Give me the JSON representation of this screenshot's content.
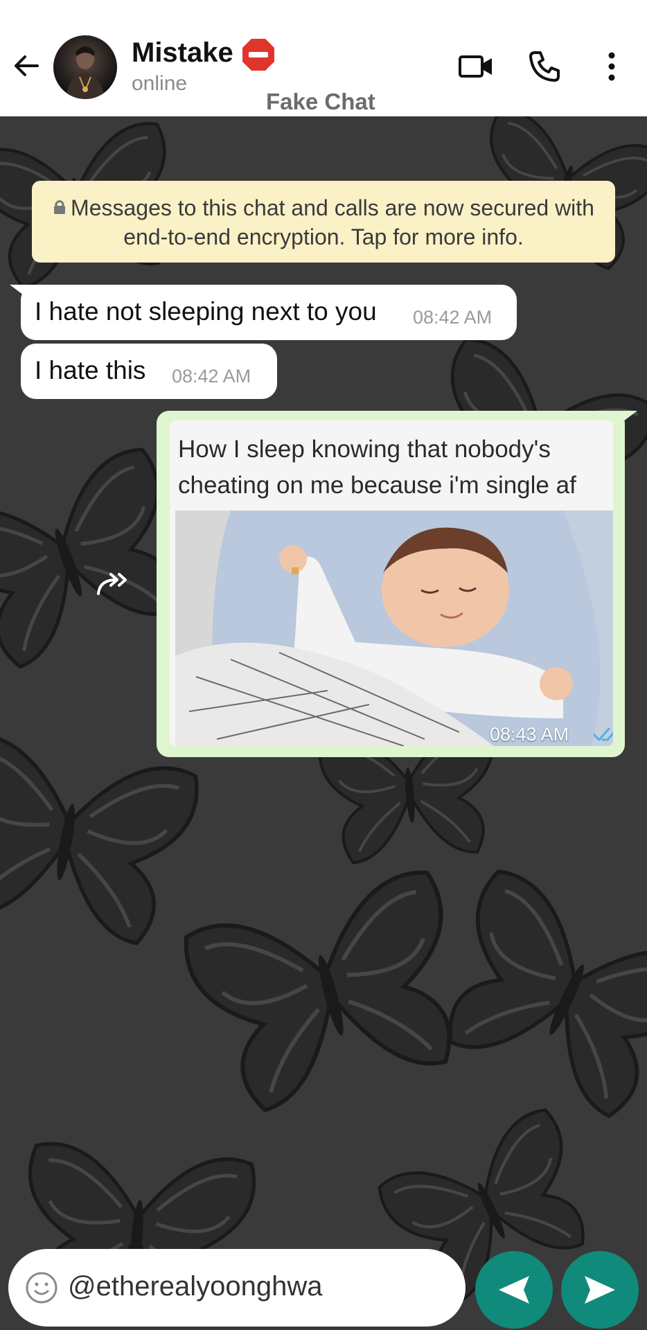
{
  "header": {
    "contact_name": "Mistake",
    "status": "online",
    "app_label": "Fake Chat"
  },
  "encryption_notice": {
    "text": "Messages to this chat and calls are now secured with end-to-end encryption. Tap for more info."
  },
  "messages": [
    {
      "direction": "incoming",
      "text": "I hate not sleeping next to you",
      "time": "08:42 AM"
    },
    {
      "direction": "incoming",
      "text": "I hate this",
      "time": "08:42 AM"
    },
    {
      "direction": "outgoing",
      "type": "image",
      "caption": "How I sleep knowing that nobody's cheating on me because i'm single af",
      "time": "08:43 AM",
      "read": true
    }
  ],
  "composer": {
    "text": "@etherealyoonghwa"
  },
  "colors": {
    "header_bg": "#ffffff",
    "chat_bg": "#3a3a3a",
    "incoming_bubble": "#ffffff",
    "outgoing_bubble": "#dff5cf",
    "notice_bg": "#fbf1c7",
    "action_button": "#108a7b",
    "read_ticks": "#4fb3e0"
  },
  "icons": [
    "back-arrow-icon",
    "stop-sign-emoji",
    "video-call-icon",
    "phone-icon",
    "more-options-icon",
    "lock-icon",
    "forward-icon",
    "double-check-icon",
    "emoji-icon",
    "left-arrow-icon",
    "send-icon"
  ]
}
